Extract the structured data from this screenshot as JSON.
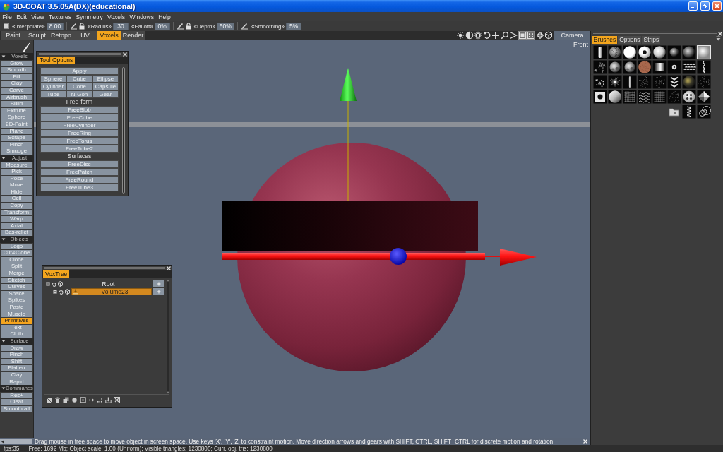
{
  "window": {
    "title": "3D-COAT 3.5.05A(DX)(educational)"
  },
  "menu": [
    "File",
    "Edit",
    "View",
    "Textures",
    "Symmetry",
    "Voxels",
    "Windows",
    "Help"
  ],
  "toolbar": [
    {
      "checkbox": {
        "checked": false
      },
      "params": [
        {
          "label": "«Interpolate»",
          "value": "8.00"
        }
      ]
    },
    {
      "pen": true,
      "lock": true,
      "params": [
        {
          "label": "«Radius»",
          "value": "30"
        },
        {
          "label": "«Falloff»",
          "value": "0%"
        }
      ]
    },
    {
      "pen": true,
      "lock": true,
      "params": [
        {
          "label": "«Depth»",
          "value": "50%"
        }
      ]
    },
    {
      "pen": true,
      "lock": false,
      "params": [
        {
          "label": "«Smoothing»",
          "value": "5%"
        }
      ]
    }
  ],
  "tabs": [
    {
      "label": "Paint",
      "selected": false
    },
    {
      "label": "Sculpt",
      "selected": false
    },
    {
      "label": "Retopo",
      "selected": false
    },
    {
      "label": "UV",
      "selected": false
    },
    {
      "label": "Voxels",
      "selected": true
    },
    {
      "label": "Render",
      "selected": false
    }
  ],
  "view_tools": [
    {
      "on": false
    },
    {
      "on": false
    },
    {
      "on": false
    },
    {
      "on": false
    },
    {
      "on": false
    },
    {
      "on": false
    },
    {
      "on": false
    },
    {
      "on": true
    },
    {
      "on": true
    },
    {
      "on": false
    },
    {
      "on": false
    }
  ],
  "camera_button": "Camera",
  "tool_palette": [
    {
      "title": "Voxels",
      "expanded": true,
      "items": [
        {
          "label": "Grow",
          "selected": false
        },
        {
          "label": "Smooth",
          "selected": false
        },
        {
          "label": "Fill",
          "selected": false
        },
        {
          "label": "Clay",
          "selected": false
        },
        {
          "label": "Carve",
          "selected": false
        },
        {
          "label": "Airbrush",
          "selected": false
        },
        {
          "label": "Build",
          "selected": false
        },
        {
          "label": "Extrude",
          "selected": false
        },
        {
          "label": "Sphere",
          "selected": false
        },
        {
          "label": "2D-Paint",
          "selected": false
        },
        {
          "label": "Plane",
          "selected": false
        },
        {
          "label": "Scrape",
          "selected": false
        },
        {
          "label": "Pinch",
          "selected": false
        },
        {
          "label": "Smudge",
          "selected": false
        }
      ]
    },
    {
      "title": "Adjust",
      "expanded": true,
      "items": [
        {
          "label": "Measure",
          "selected": false
        },
        {
          "label": "Pick",
          "selected": false
        },
        {
          "label": "Pose",
          "selected": false
        },
        {
          "label": "Move",
          "selected": false
        },
        {
          "label": "Hide",
          "selected": false
        },
        {
          "label": "Cell",
          "selected": false
        },
        {
          "label": "Copy",
          "selected": false
        },
        {
          "label": "Transform",
          "selected": false
        },
        {
          "label": "Warp",
          "selected": false
        },
        {
          "label": "Axial",
          "selected": false
        },
        {
          "label": "Bas-relief",
          "selected": false
        }
      ]
    },
    {
      "title": "Objects",
      "expanded": true,
      "items": [
        {
          "label": "Logo",
          "selected": false
        },
        {
          "label": "Cut&Clone",
          "selected": false
        },
        {
          "label": "Clone",
          "selected": false
        },
        {
          "label": "Split",
          "selected": false
        },
        {
          "label": "Merge",
          "selected": false
        },
        {
          "label": "Sketch",
          "selected": false
        },
        {
          "label": "Curves",
          "selected": false
        },
        {
          "label": "Snake",
          "selected": false
        },
        {
          "label": "Spikes",
          "selected": false
        },
        {
          "label": "Paste",
          "selected": false
        },
        {
          "label": "Muscle",
          "selected": false
        },
        {
          "label": "Primitives",
          "selected": true
        },
        {
          "label": "Text",
          "selected": false
        },
        {
          "label": "Cloth",
          "selected": false
        }
      ]
    },
    {
      "title": "Surface",
      "expanded": true,
      "items": [
        {
          "label": "Draw",
          "selected": false
        },
        {
          "label": "Pinch",
          "selected": false
        },
        {
          "label": "Shift",
          "selected": false
        },
        {
          "label": "Flatten",
          "selected": false
        },
        {
          "label": "Clay",
          "selected": false
        },
        {
          "label": "Rapid",
          "selected": false
        }
      ]
    },
    {
      "title": "Commands",
      "expanded": true,
      "items": [
        {
          "label": "Res+",
          "selected": false
        },
        {
          "label": "Clear",
          "selected": false
        },
        {
          "label": "Smooth all",
          "selected": false
        }
      ]
    }
  ],
  "viewport": {
    "view_label": "Front"
  },
  "tool_options": {
    "tabs": [
      {
        "label": "Tool Options",
        "selected": true
      }
    ],
    "apply": "Apply",
    "shapes": [
      "Sphere",
      "Cube",
      "Ellipse",
      "Cylinder",
      "Cone",
      "Capsule",
      "Tube",
      "N-Gon",
      "Gear"
    ],
    "groups": [
      {
        "title": "Free-form",
        "items": [
          "FreeBlob",
          "FreeCube",
          "FreeCylinder",
          "FreeRing",
          "FreeTorus",
          "FreeTube2"
        ]
      },
      {
        "title": "Surfaces",
        "items": [
          "FreeDisc",
          "FreePatch",
          "FreeRound",
          "FreeTube3"
        ]
      }
    ]
  },
  "voxtree": {
    "tabs": [
      {
        "label": "VoxTree",
        "selected": true
      }
    ],
    "nodes": [
      {
        "name": "Root",
        "expanded": true,
        "selected": false,
        "children": [
          {
            "name": "Volume23",
            "expanded": true,
            "selected": true
          }
        ]
      }
    ]
  },
  "brushes_panel": {
    "tabs": [
      {
        "label": "Brushes",
        "selected": true
      },
      {
        "label": "Options",
        "selected": false
      },
      {
        "label": "Strips",
        "selected": false
      }
    ],
    "brushes": [
      {
        "selected": false
      },
      {
        "selected": false
      },
      {
        "selected": false
      },
      {
        "selected": false
      },
      {
        "selected": false
      },
      {
        "selected": false
      },
      {
        "selected": false
      },
      {
        "selected": true
      },
      {
        "selected": false
      },
      {
        "selected": false
      },
      {
        "selected": false
      },
      {
        "selected": false
      },
      {
        "selected": false
      },
      {
        "selected": false
      },
      {
        "selected": false
      },
      {
        "selected": false
      },
      {
        "selected": false
      },
      {
        "selected": false
      },
      {
        "selected": false
      },
      {
        "selected": false
      },
      {
        "selected": false
      },
      {
        "selected": false
      },
      {
        "selected": false
      },
      {
        "selected": false
      },
      {
        "selected": false
      },
      {
        "selected": false
      },
      {
        "selected": false
      },
      {
        "selected": false
      },
      {
        "selected": false
      },
      {
        "selected": false
      },
      {
        "selected": false
      },
      {
        "selected": false
      },
      {
        "selected": false
      },
      {
        "selected": false
      },
      {
        "selected": false
      }
    ]
  },
  "hint_bar": {
    "message": "Drag mouse in free space to move object in screen space. Use keys 'X', 'Y', 'Z' to constraint motion. Move direction arrows and gears with SHIFT, CTRL, SHIFT+CTRL for discrete motion and rotation."
  },
  "status_bar": {
    "fps": "fps:35;",
    "info": "Free: 1692 Mb; Object scale: 1.00 (Uniform); Visible triangles: 1230800; Curr. obj. tris: 1230800"
  }
}
